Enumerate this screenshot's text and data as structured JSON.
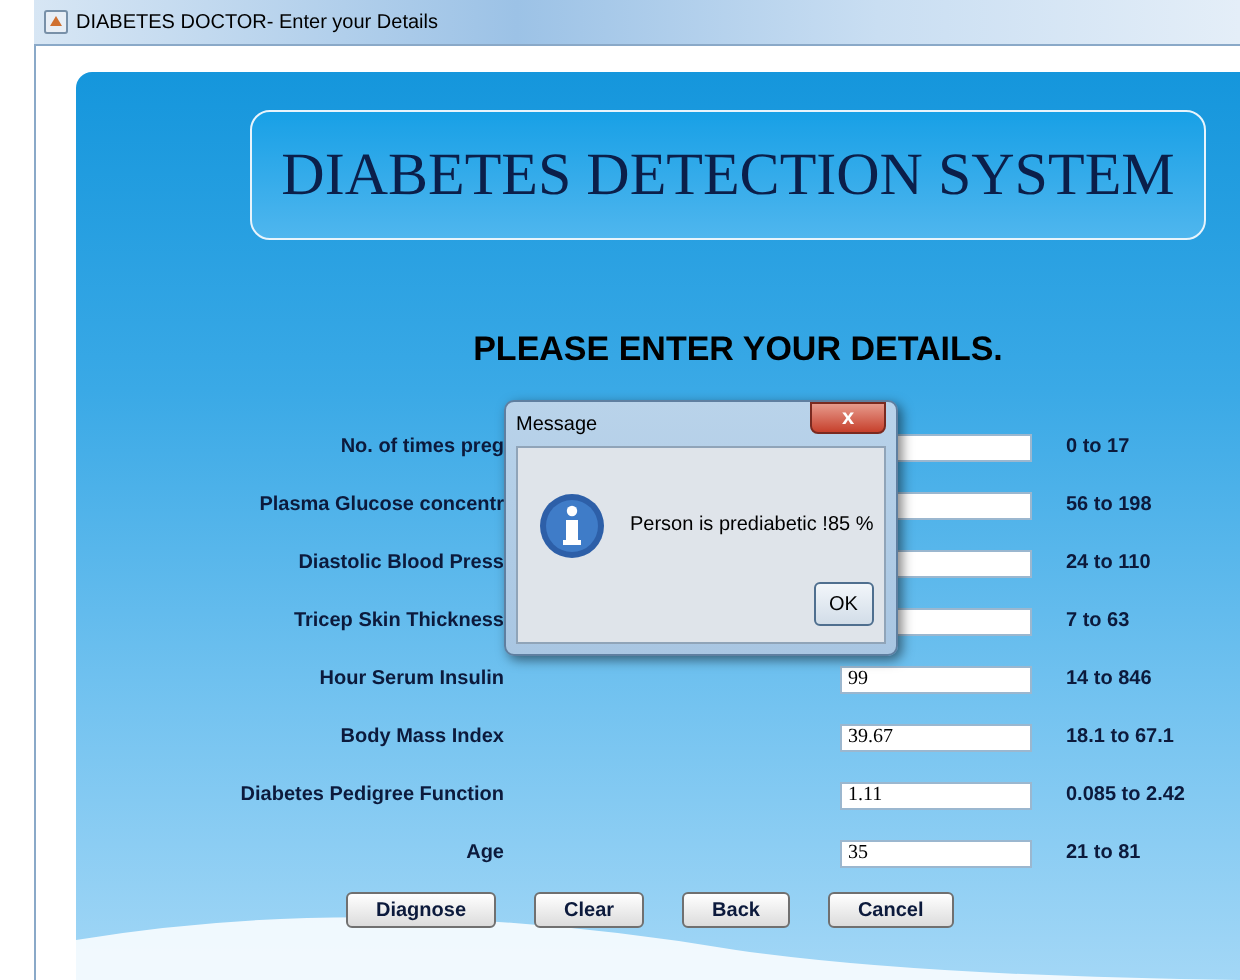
{
  "window": {
    "title": "DIABETES DOCTOR- Enter your Details"
  },
  "banner": {
    "title": "DIABETES DETECTION SYSTEM"
  },
  "heading": "PLEASE ENTER YOUR DETAILS.",
  "fields": [
    {
      "label": "No. of times preg",
      "range": "0 to 17"
    },
    {
      "label": "Plasma Glucose concentr",
      "range": "56 to 198"
    },
    {
      "label": "Diastolic Blood Press",
      "range": "24 to 110"
    },
    {
      "label": "Tricep Skin Thickness",
      "range": "7 to 63"
    },
    {
      "label": "Hour Serum Insulin",
      "value": "99",
      "range": "14 to 846"
    },
    {
      "label": "Body Mass Index",
      "value": "39.67",
      "range": "18.1 to 67.1"
    },
    {
      "label": "Diabetes Pedigree Function",
      "value": "1.11",
      "range": "0.085 to 2.42"
    },
    {
      "label": "Age",
      "value": "35",
      "range": "21 to 81"
    }
  ],
  "buttons": [
    "Diagnose",
    "Clear",
    "Back",
    "Cancel"
  ],
  "dialog": {
    "title": "Message",
    "close": "x",
    "message": "Person is prediabetic !85 %",
    "button": "OK"
  }
}
